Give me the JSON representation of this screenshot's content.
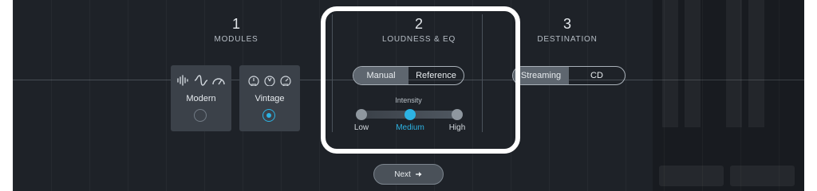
{
  "steps": [
    {
      "number": "1",
      "title": "MODULES"
    },
    {
      "number": "2",
      "title": "LOUDNESS & EQ"
    },
    {
      "number": "3",
      "title": "DESTINATION"
    }
  ],
  "modules": [
    {
      "label": "Modern",
      "icons": [
        "waveform-icon",
        "eq-curve-icon",
        "meter-gauge-icon"
      ],
      "selected": false
    },
    {
      "label": "Vintage",
      "icons": [
        "vintage-knob-icon",
        "vintage-knob-icon",
        "vintage-knob-icon"
      ],
      "selected": true
    }
  ],
  "loudness_mode": {
    "options": [
      "Manual",
      "Reference"
    ],
    "active": "Manual"
  },
  "intensity": {
    "label": "Intensity",
    "stops": [
      "Low",
      "Medium",
      "High"
    ],
    "selected": "Medium"
  },
  "destination": {
    "options": [
      "Streaming",
      "CD"
    ],
    "active": "Streaming"
  },
  "next_label": "Next",
  "colors": {
    "accent": "#2db3e3",
    "panel": "#1e2228",
    "card": "#3b4149",
    "highlight": "#ffffff"
  }
}
